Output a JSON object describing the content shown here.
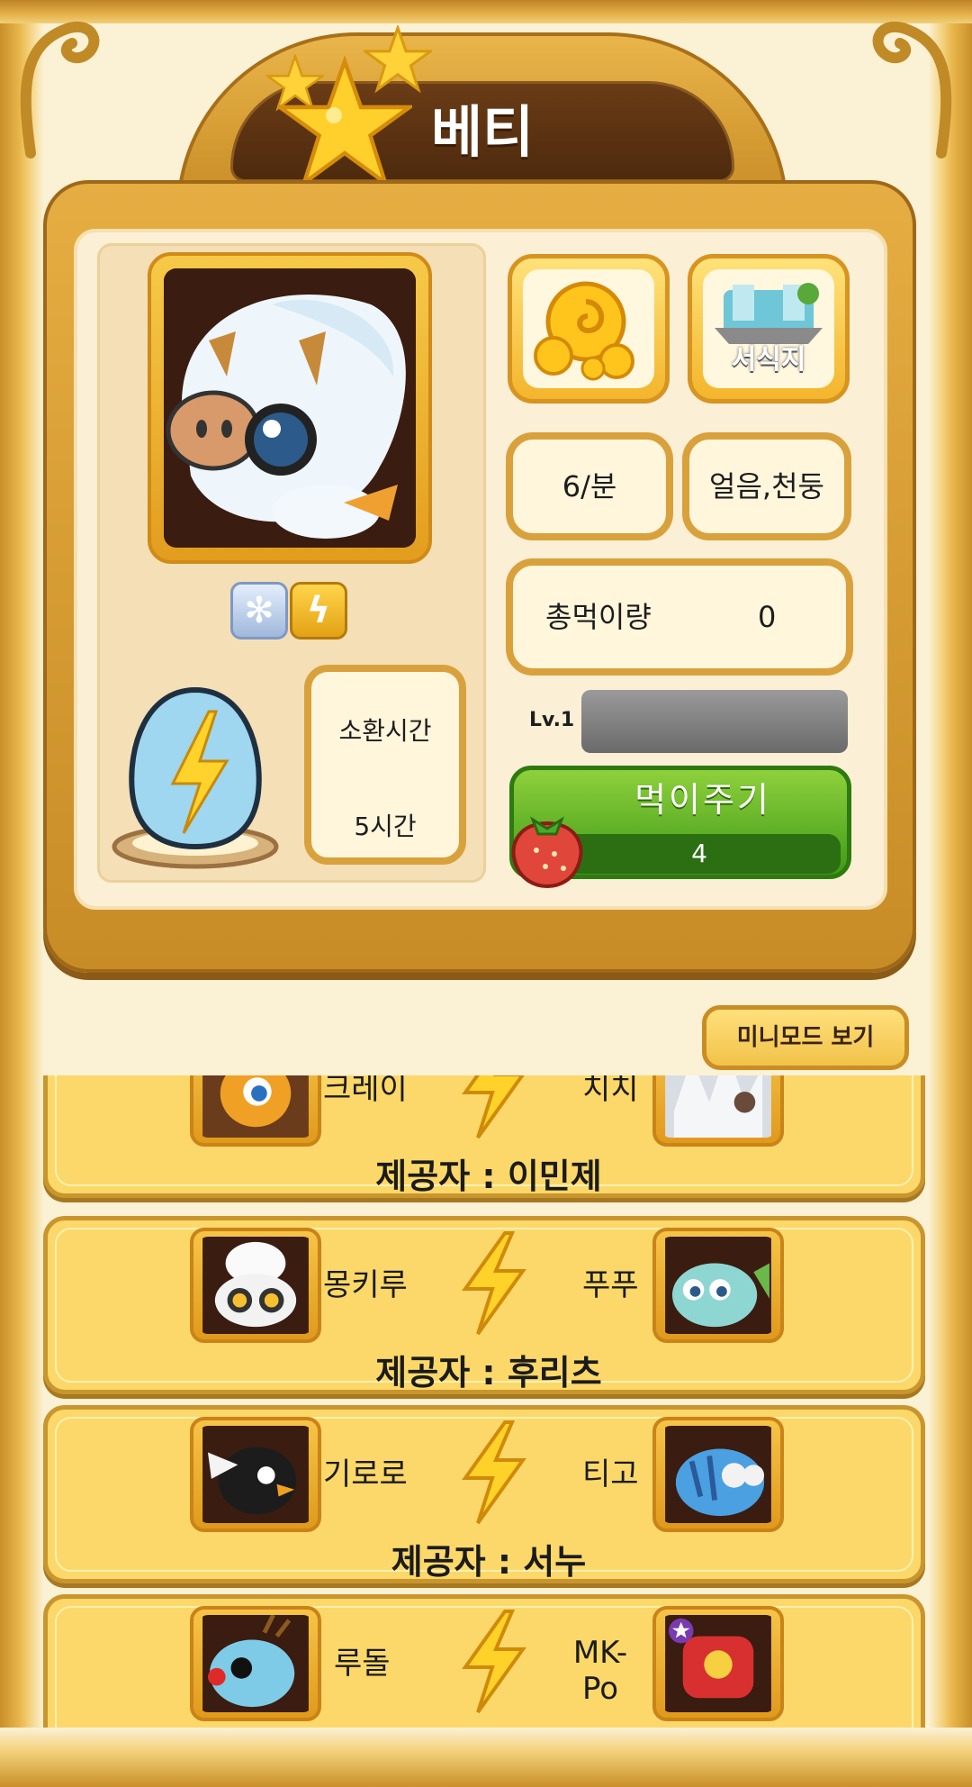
{
  "pet": {
    "name": "베티",
    "elements": [
      "snowflake-icon",
      "lightning-icon"
    ],
    "summon": {
      "label": "소환시간",
      "value": "5시간"
    },
    "rate": "6/분",
    "habitat_types": "얼음,천둥",
    "habitat_label": "서식지",
    "food_total": {
      "label": "총먹이량",
      "value": "0"
    },
    "level_label": "Lv.1",
    "feed": {
      "label": "먹이주기",
      "count": "4"
    }
  },
  "mini_mode_label": "미니모드 보기",
  "combos": [
    {
      "left": "크레이",
      "right": "치치",
      "provider": "제공자 : 이민제"
    },
    {
      "left": "몽키루",
      "right": "푸푸",
      "provider": "제공자 : 후리츠"
    },
    {
      "left": "기로로",
      "right": "티고",
      "provider": "제공자 : 서누"
    },
    {
      "left": "루돌",
      "right": "MK-Po",
      "provider": ""
    }
  ],
  "colors": {
    "frame": "#e5ad42",
    "cream": "#fbefd6",
    "card": "#fbd869",
    "feed_green": "#3f9a18",
    "title_plaque": "#4e2a0e"
  }
}
